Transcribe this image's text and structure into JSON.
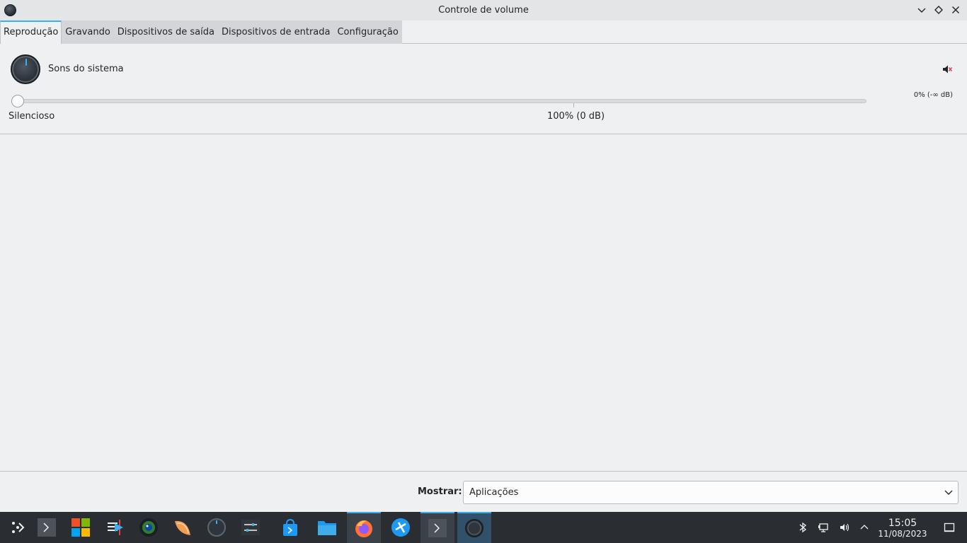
{
  "window": {
    "title": "Controle de volume"
  },
  "tabs": [
    {
      "label": "Reprodução",
      "active": true
    },
    {
      "label": "Gravando",
      "active": false
    },
    {
      "label": "Dispositivos de saída",
      "active": false
    },
    {
      "label": "Dispositivos de entrada",
      "active": false
    },
    {
      "label": "Configuração",
      "active": false
    }
  ],
  "stream": {
    "name": "Sons do sistema",
    "volume_readout": "0% (-∞ dB)",
    "volume_percent": 0,
    "muted": true,
    "scale_min_label": "Silencioso",
    "scale_100_label": "100% (0 dB)"
  },
  "footer": {
    "show_label": "Mostrar:",
    "show_value": "Aplicações"
  },
  "taskbar": {
    "apps": [
      "application-launcher-icon",
      "terminal-icon",
      "windows-logo-icon",
      "kdenlive-icon",
      "camera-lens-icon",
      "citrus-app-icon",
      "volume-knob-icon",
      "settings-sliders-icon",
      "store-bag-icon",
      "folder-icon",
      "firefox-icon",
      "network-app-icon",
      "terminal-icon",
      "volume-control-icon"
    ],
    "clock_time": "15:05",
    "clock_date": "11/08/2023"
  },
  "colors": {
    "accent": "#3daee9",
    "window_bg": "#eff0f1",
    "taskbar_bg": "#2a2e32"
  }
}
